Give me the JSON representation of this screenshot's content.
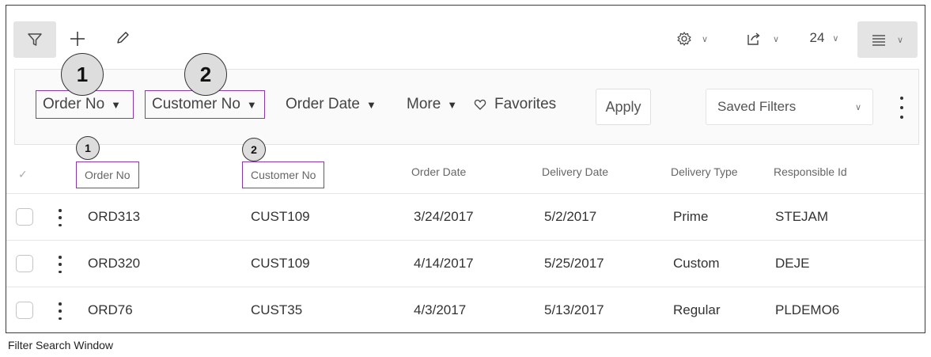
{
  "toolbar": {
    "page_size": "24"
  },
  "filter_panel": {
    "fields": [
      {
        "label": "Order No"
      },
      {
        "label": "Customer No"
      },
      {
        "label": "Order Date"
      },
      {
        "label": "More"
      }
    ],
    "favorites_label": "Favorites",
    "apply_label": "Apply",
    "saved_filters_label": "Saved Filters"
  },
  "callouts": {
    "one": "1",
    "two": "2"
  },
  "table": {
    "columns": [
      "Order No",
      "Customer No",
      "Order Date",
      "Delivery Date",
      "Delivery Type",
      "Responsible Id"
    ],
    "rows": [
      [
        "ORD313",
        "CUST109",
        "3/24/2017",
        "5/2/2017",
        "Prime",
        "STEJAM"
      ],
      [
        "ORD320",
        "CUST109",
        "4/14/2017",
        "5/25/2017",
        "Custom",
        "DEJE"
      ],
      [
        "ORD76",
        "CUST35",
        "4/3/2017",
        "5/13/2017",
        "Regular",
        "PLDEMO6"
      ]
    ]
  },
  "caption": "Filter Search Window",
  "colors": {
    "highlight": "#8a3aa6",
    "toolbar_active_bg": "#e4e4e4"
  }
}
